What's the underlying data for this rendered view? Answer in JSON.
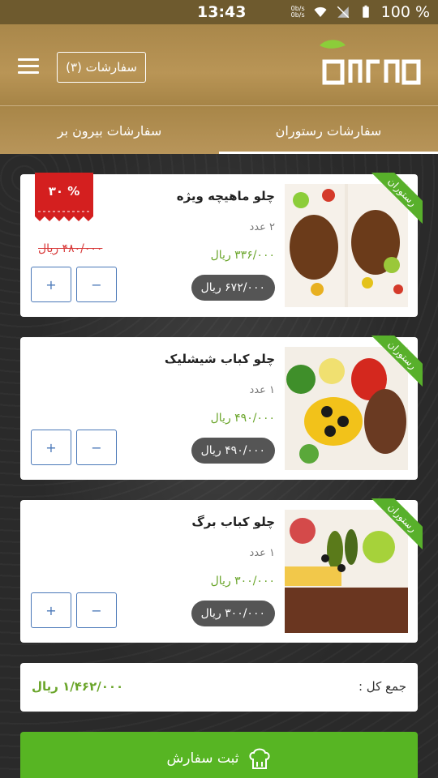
{
  "status_bar": {
    "time": "13:43",
    "net_up": "0b/s",
    "net_down": "0b/s",
    "battery": "100 %"
  },
  "header": {
    "orders_button": "سفارشات (۳)",
    "logo_icon": "leaf-logo-icon",
    "menu_icon": "hamburger-icon"
  },
  "tabs": [
    {
      "label": "سفارشات رستوران",
      "active": true
    },
    {
      "label": "سفارشات بیرون بر",
      "active": false
    }
  ],
  "items": [
    {
      "name": "چلو ماهیچه ویژه",
      "qty": "۲ عدد",
      "unit_price": "۳۳۶/۰۰۰ ریال",
      "total": "۶۷۲/۰۰۰ ریال",
      "old_price": "۴۸۰/۰۰۰ ریال",
      "discount": "۳۰ %",
      "ribbon": "رستوران",
      "plus": "+",
      "minus": "−"
    },
    {
      "name": "چلو کباب شیشلیک",
      "qty": "۱ عدد",
      "unit_price": "۴۹۰/۰۰۰ ریال",
      "total": "۴۹۰/۰۰۰ ریال",
      "ribbon": "رستوران",
      "plus": "+",
      "minus": "−"
    },
    {
      "name": "چلو کباب برگ",
      "qty": "۱ عدد",
      "unit_price": "۳۰۰/۰۰۰ ریال",
      "total": "۳۰۰/۰۰۰ ریال",
      "ribbon": "رستوران",
      "plus": "+",
      "minus": "−"
    }
  ],
  "summary": {
    "label": "جمع کل :",
    "value": "۱/۴۶۲/۰۰۰ ریال"
  },
  "submit": {
    "label": "ثبت سفارش",
    "icon": "chef-hat-icon"
  },
  "colors": {
    "accent_green": "#57b523",
    "header_gold": "#b99556",
    "price_green": "#6aa52a",
    "discount_red": "#d83a3a"
  }
}
